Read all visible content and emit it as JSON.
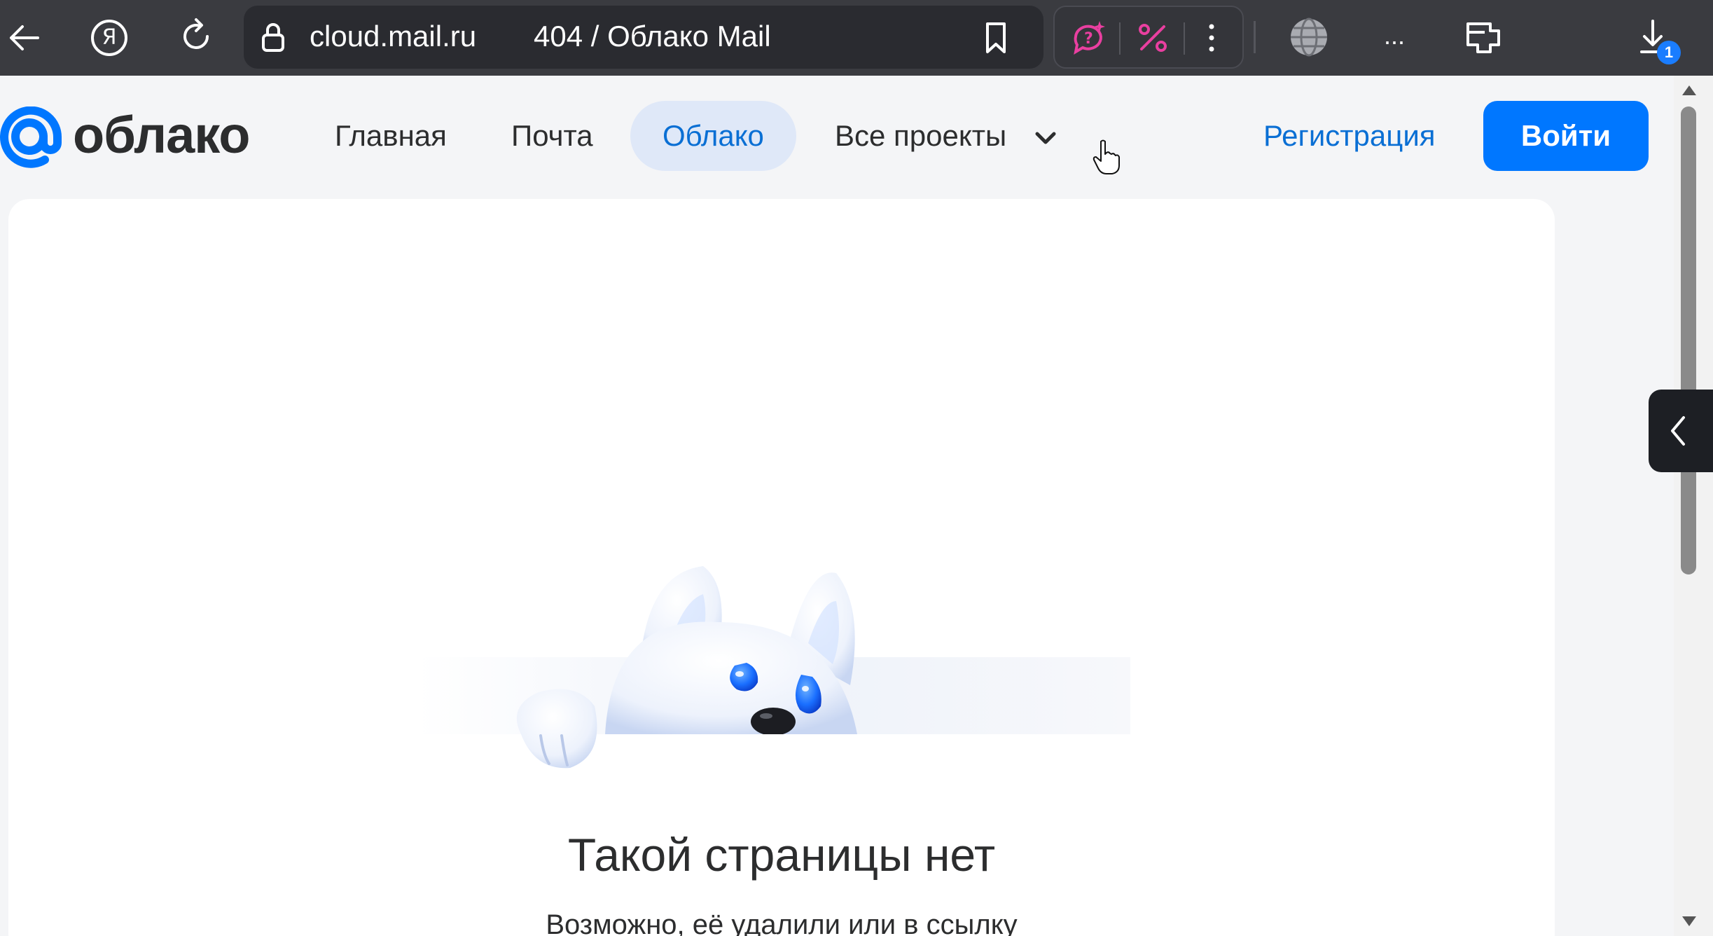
{
  "browser": {
    "address_domain": "cloud.mail.ru",
    "page_title": "404 / Облако Mail",
    "overflow_label": "...",
    "downloads_count": "1",
    "yandex_glyph": "Я"
  },
  "header": {
    "logo_text": "облако",
    "nav": [
      {
        "label": "Главная"
      },
      {
        "label": "Почта"
      },
      {
        "label": "Облако",
        "active": true
      },
      {
        "label": "Все проекты"
      }
    ],
    "register_label": "Регистрация",
    "login_label": "Войти"
  },
  "error": {
    "title": "Такой страницы нет",
    "description": "Возможно, её удалили или в ссылку"
  },
  "colors": {
    "accent": "#0077ff",
    "link": "#0a6fd4",
    "active_nav_bg": "#dfe8f8",
    "chrome_bg": "#3a3b40",
    "ext_pink": "#e93fa0"
  },
  "icons": [
    "back-arrow-icon",
    "yandex-icon",
    "reload-icon",
    "lock-icon",
    "bookmark-icon",
    "ai-assistant-icon",
    "discount-icon",
    "more-vertical-icon",
    "globe-icon",
    "extensions-icon",
    "download-icon",
    "chevron-down-icon",
    "chevron-left-icon",
    "scroll-up-icon",
    "scroll-down-icon",
    "hand-cursor-icon"
  ]
}
